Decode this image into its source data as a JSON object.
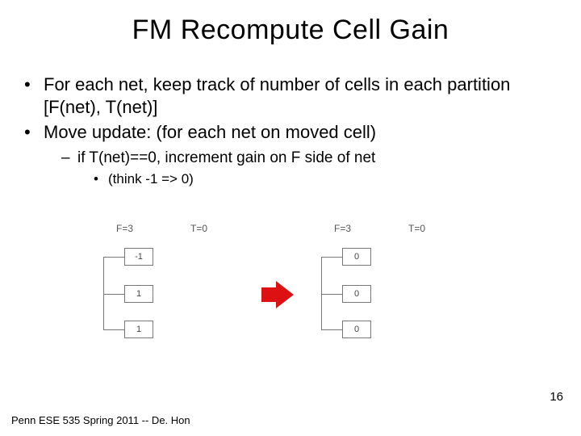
{
  "title": "FM Recompute Cell Gain",
  "bullets": {
    "b1a": "For each net, keep track of number of cells in each partition [F(net), T(net)]",
    "b1b": "Move update: (for each net on moved cell)",
    "b2a": "if T(net)==0, increment gain on F side of net",
    "b3a": "(think -1 => 0)"
  },
  "diagram": {
    "left": {
      "f_label": "F=3",
      "t_label": "T=0",
      "cells": [
        "-1",
        "1",
        "1"
      ]
    },
    "right": {
      "f_label": "F=3",
      "t_label": "T=0",
      "cells": [
        "0",
        "0",
        "0"
      ]
    }
  },
  "page_number": "16",
  "footer": "Penn ESE 535 Spring 2011 -- De. Hon"
}
